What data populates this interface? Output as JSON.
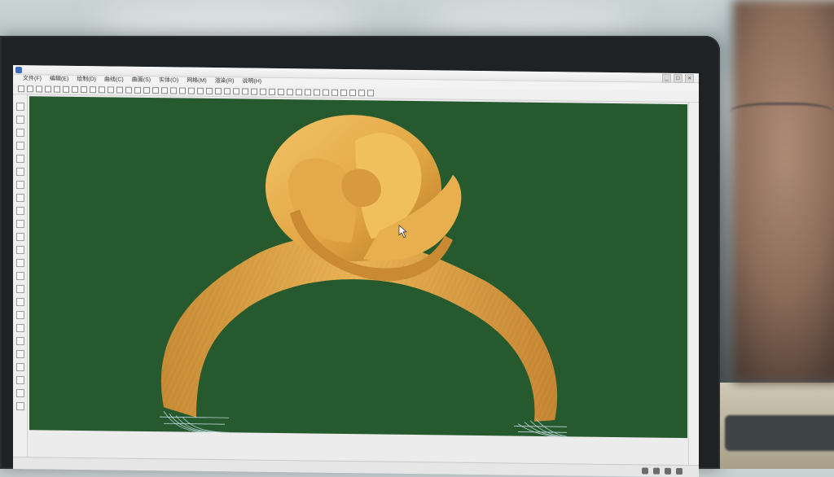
{
  "window": {
    "title": "",
    "controls": [
      "_",
      "□",
      "×"
    ]
  },
  "menu": {
    "items": [
      "文件(F)",
      "编辑(E)",
      "绘制(D)",
      "曲线(C)",
      "曲面(S)",
      "实体(O)",
      "网格(M)",
      "渲染(R)",
      "说明(H)"
    ]
  },
  "toolbar": {
    "buttons": [
      "new",
      "open",
      "save",
      "print",
      "cut",
      "copy",
      "paste",
      "undo",
      "redo",
      "pan",
      "rotate",
      "zoom-in",
      "zoom-out",
      "zoom-window",
      "zoom-extents",
      "shade",
      "wire",
      "point",
      "line",
      "curve",
      "circle",
      "arc",
      "rect",
      "poly",
      "box",
      "sphere",
      "cylinder",
      "cone",
      "torus",
      "surface",
      "boolean",
      "fillet",
      "chamfer",
      "mirror",
      "array",
      "move",
      "scale",
      "layer",
      "properties",
      "render"
    ]
  },
  "left_toolbox": {
    "buttons": [
      "select",
      "line",
      "curve",
      "arc",
      "circle",
      "rect",
      "polyline",
      "point",
      "surface",
      "solid",
      "transform",
      "dimension",
      "snap",
      "grid",
      "ortho",
      "osnap",
      "history",
      "layers",
      "light",
      "camera",
      "material",
      "render",
      "view",
      "help"
    ]
  },
  "viewport": {
    "background_color": "#26592e",
    "model_color": "#e3a746",
    "model_shadow": "#b97c27",
    "wire_color": "#cfe6f2"
  },
  "statusbar": {
    "tray_icons": [
      "speaker-icon",
      "network-icon",
      "ime-icon",
      "flag-icon"
    ]
  }
}
